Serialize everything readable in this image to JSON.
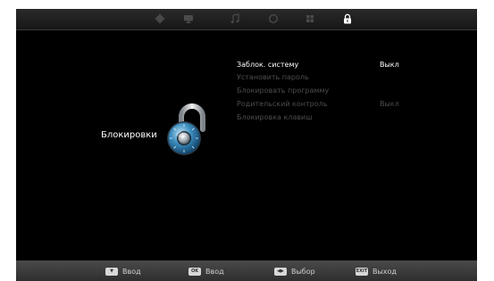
{
  "top_tabs": [
    {
      "icon": "gear-icon",
      "selected": false
    },
    {
      "icon": "monitor-icon",
      "selected": false
    },
    {
      "icon": "music-note-icon",
      "selected": false
    },
    {
      "icon": "clock-icon",
      "selected": false
    },
    {
      "icon": "grid-icon",
      "selected": false
    },
    {
      "icon": "lock-icon",
      "selected": true
    }
  ],
  "main": {
    "title": "Блокировки",
    "lock_icon": "combination-lock-icon"
  },
  "menu": {
    "items": [
      {
        "label": "Заблок. систему",
        "value": "Выкл",
        "active": true
      },
      {
        "label": "Установить пароль",
        "value": "",
        "active": false
      },
      {
        "label": "Блокировать программу",
        "value": "",
        "active": false
      },
      {
        "label": "Родительский контроль",
        "value": "Выкл",
        "active": false
      },
      {
        "label": "Блокировка клавиш",
        "value": "",
        "active": false
      }
    ]
  },
  "bottom_hints": [
    {
      "key": "▼",
      "label": "Ввод"
    },
    {
      "key": "OK",
      "label": "Ввод"
    },
    {
      "key": "◀▶",
      "label": "Выбор"
    },
    {
      "key": "EXIT",
      "label": "Выход"
    }
  ],
  "colors": {
    "background": "#000000",
    "active_text": "#ffffff",
    "inactive_text": "#4d4d4d",
    "selected_tab": "#ffffff",
    "unselected_tab": "#4a4a4a"
  }
}
